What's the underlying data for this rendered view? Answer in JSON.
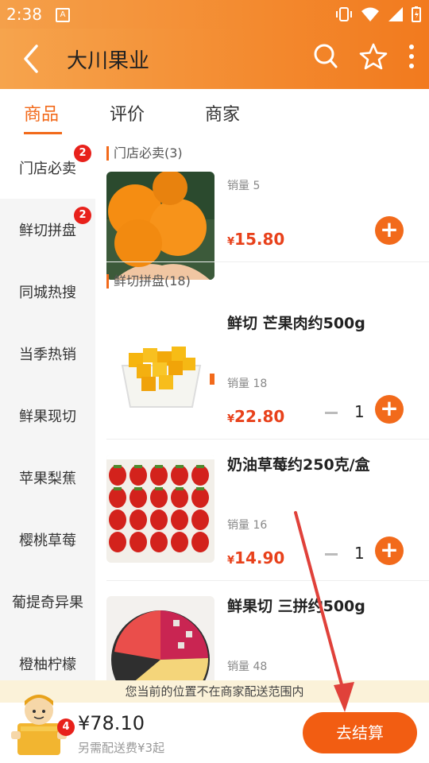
{
  "status_bar": {
    "time": "2:38",
    "a_icon": "A"
  },
  "header": {
    "title": "大川果业"
  },
  "tabs": [
    {
      "label": "商品",
      "active": true
    },
    {
      "label": "评价",
      "active": false
    },
    {
      "label": "商家",
      "active": false
    }
  ],
  "sidebar": [
    {
      "label": "门店必卖",
      "badge": "2",
      "active": true
    },
    {
      "label": "鲜切拼盘",
      "badge": "2",
      "active": false
    },
    {
      "label": "同城热搜"
    },
    {
      "label": "当季热销"
    },
    {
      "label": "鲜果现切"
    },
    {
      "label": "苹果梨蕉"
    },
    {
      "label": "樱桃草莓"
    },
    {
      "label": "葡提奇异果"
    },
    {
      "label": "橙柚柠檬"
    }
  ],
  "sections": {
    "top": {
      "title": "门店必卖(3)"
    },
    "fresh": {
      "title": "鲜切拼盘(18)"
    }
  },
  "products": [
    {
      "name": "",
      "sales": "销量 5",
      "price": "15.80",
      "currency": "¥"
    },
    {
      "name": "鲜切 芒果肉约500g",
      "sales": "销量 18",
      "price": "22.80",
      "currency": "¥",
      "qty": "1"
    },
    {
      "name": "奶油草莓约250克/盒",
      "sales": "销量 16",
      "price": "14.90",
      "currency": "¥",
      "qty": "1"
    },
    {
      "name": "鲜果切 三拼约500g",
      "sales": "销量 48"
    }
  ],
  "plus_symbol": "+",
  "notice": "您当前的位置不在商家配送范围内",
  "cart": {
    "count": "4",
    "total": "¥78.10",
    "delivery_note": "另需配送费¥3起",
    "checkout_label": "去结算"
  },
  "colors": {
    "accent": "#f26a1b",
    "header_gradient_start": "#f6a44d",
    "header_gradient_end": "#f27a1e",
    "badge": "#e8211b",
    "price": "#e8411b",
    "annotation_arrow": "#e0413a"
  },
  "icons": [
    "back-icon",
    "search-icon",
    "star-icon",
    "more-icon",
    "vibrate-icon",
    "wifi-icon",
    "signal-icon",
    "battery-icon"
  ]
}
